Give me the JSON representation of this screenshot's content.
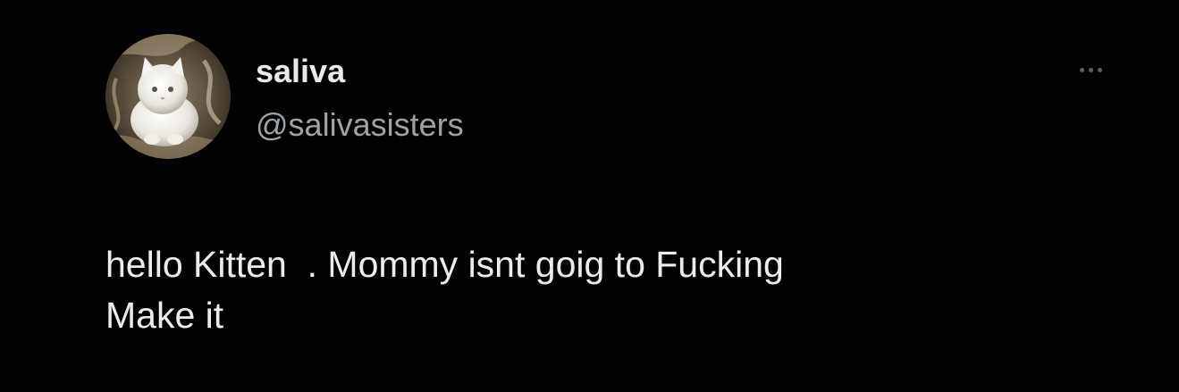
{
  "tweet": {
    "author": {
      "display_name": "saliva",
      "handle": "@salivasisters",
      "avatar_icon": "white-kitten-avatar"
    },
    "more_icon": "more-horizontal-icon",
    "text_lines": [
      "hello Kitten  . Mommy isnt goig to Fucking",
      "Make it"
    ]
  },
  "colors": {
    "background": "#000000",
    "name": "#e7e9ea",
    "handle": "#9ea3a8",
    "text": "#ececec"
  }
}
